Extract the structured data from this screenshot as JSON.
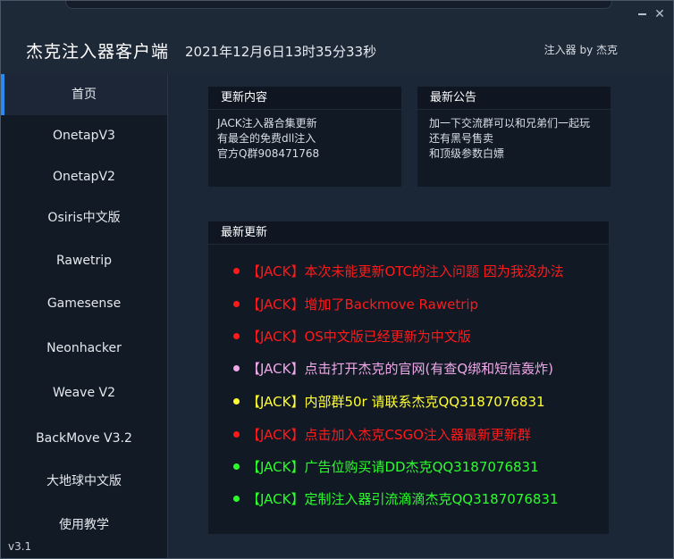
{
  "header": {
    "title": "杰克注入器客户端",
    "datetime": "2021年12月6日13时35分33秒",
    "author": "注入器 by 杰克"
  },
  "sidebar": {
    "items": [
      {
        "label": "首页",
        "active": true
      },
      {
        "label": "OnetapV3"
      },
      {
        "label": "OnetapV2"
      },
      {
        "label": "Osiris中文版"
      },
      {
        "label": "Rawetrip"
      },
      {
        "label": "Gamesense"
      },
      {
        "label": "Neonhacker"
      },
      {
        "label": "Weave V2"
      },
      {
        "label": "BackMove V3.2"
      },
      {
        "label": "大地球中文版"
      },
      {
        "label": "使用教学"
      }
    ],
    "version": "v3.1"
  },
  "news": {
    "title": "更新内容",
    "lines": [
      "JACK注入器合集更新",
      "有最全的免费dll注入",
      "官方Q群908471768"
    ]
  },
  "announce": {
    "title": "最新公告",
    "lines": [
      "加一下交流群可以和兄弟们一起玩",
      "还有黑号售卖",
      "和顶级参数白嫖"
    ]
  },
  "updates": {
    "title": "最新更新",
    "items": [
      {
        "text": "【JACK】本次未能更新OTC的注入问题 因为我没办法",
        "color": "#ff1a1a"
      },
      {
        "text": "【JACK】增加了Backmove Rawetrip",
        "color": "#ff1a1a"
      },
      {
        "text": "【JACK】OS中文版已经更新为中文版",
        "color": "#ff1a1a"
      },
      {
        "text": "【JACK】点击打开杰克的官网(有查Q绑和短信轰炸)",
        "color": "#f0a8e8"
      },
      {
        "text": "【JACK】内部群50r 请联系杰克QQ3187076831",
        "color": "#ffff33"
      },
      {
        "text": "【JACK】点击加入杰克CSGO注入器最新更新群",
        "color": "#ff1a1a"
      },
      {
        "text": "【JACK】广告位购买请DD杰克QQ3187076831",
        "color": "#2bff2b"
      },
      {
        "text": "【JACK】定制注入器引流滴滴杰克QQ3187076831",
        "color": "#2bff2b"
      }
    ]
  }
}
